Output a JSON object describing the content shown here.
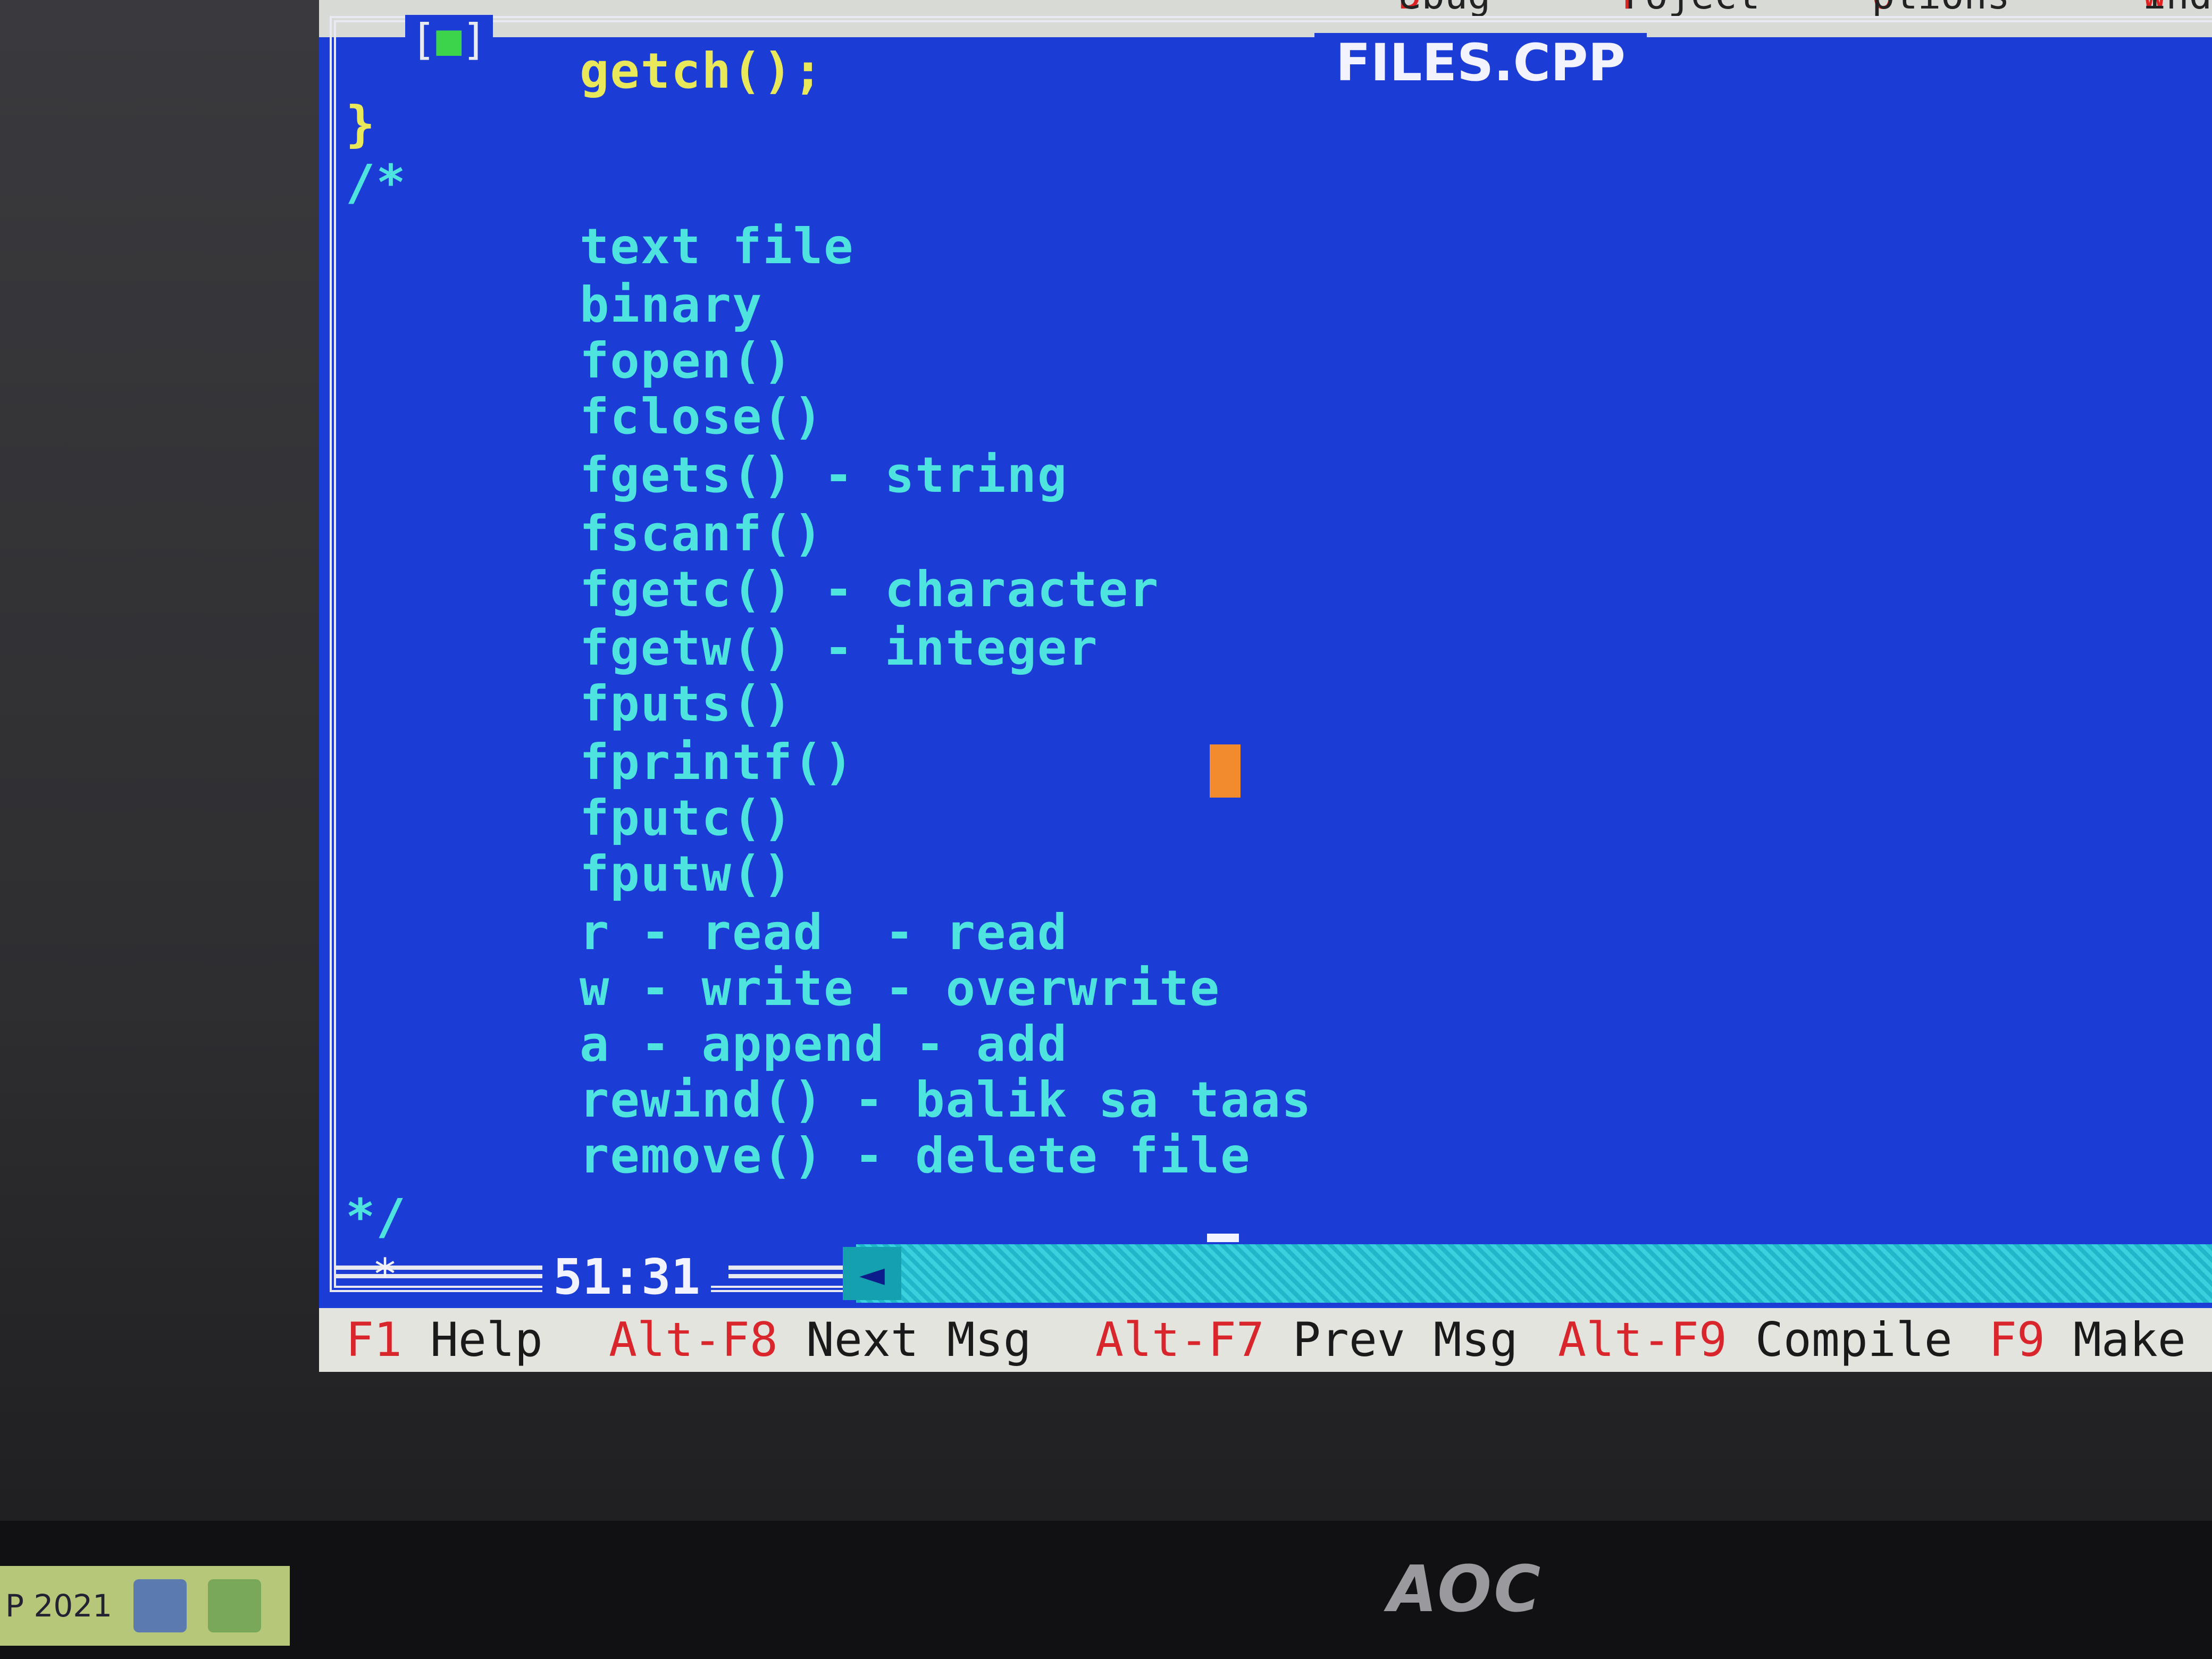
{
  "menubar": {
    "items": [
      {
        "hot": "D",
        "rest": "ebug"
      },
      {
        "hot": "P",
        "rest": "roject"
      },
      {
        "hot": "O",
        "rest": "ptions"
      },
      {
        "hot": "W",
        "rest": "indow"
      }
    ]
  },
  "window": {
    "title": "FILES.CPP",
    "close_box": "[",
    "close_mark": "■",
    "close_end": "]"
  },
  "editor": {
    "lines": [
      "getch();",
      "}",
      "/*",
      "text file",
      "binary",
      "fopen()",
      "fclose()",
      "fgets() - string",
      "fscanf()",
      "fgetc() - character",
      "fgetw() - integer",
      "fputs()",
      "fprintf()",
      "fputc()",
      "fputw()",
      "r - read  - read",
      "w - write - overwrite",
      "a - append - add",
      "rewind() - balik sa taas",
      "remove() - delete file",
      "*/"
    ]
  },
  "status": {
    "modified_mark": "*",
    "position": "51:31",
    "scroll_arrow": "◄"
  },
  "hotkeys": [
    {
      "key": "F1",
      "label": "Help"
    },
    {
      "key": "Alt-F8",
      "label": "Next Msg"
    },
    {
      "key": "Alt-F7",
      "label": "Prev Msg"
    },
    {
      "key": "Alt-F9",
      "label": "Compile"
    },
    {
      "key": "F9",
      "label": "Make"
    }
  ],
  "taskbar": {
    "text": "P 2021"
  },
  "monitor": {
    "brand": "AOC"
  },
  "colors": {
    "editor_bg": "#1c3cd6",
    "code_text": "#4fe3e0",
    "hotkey_red": "#d8262c",
    "cursor": "#f28a2e"
  }
}
